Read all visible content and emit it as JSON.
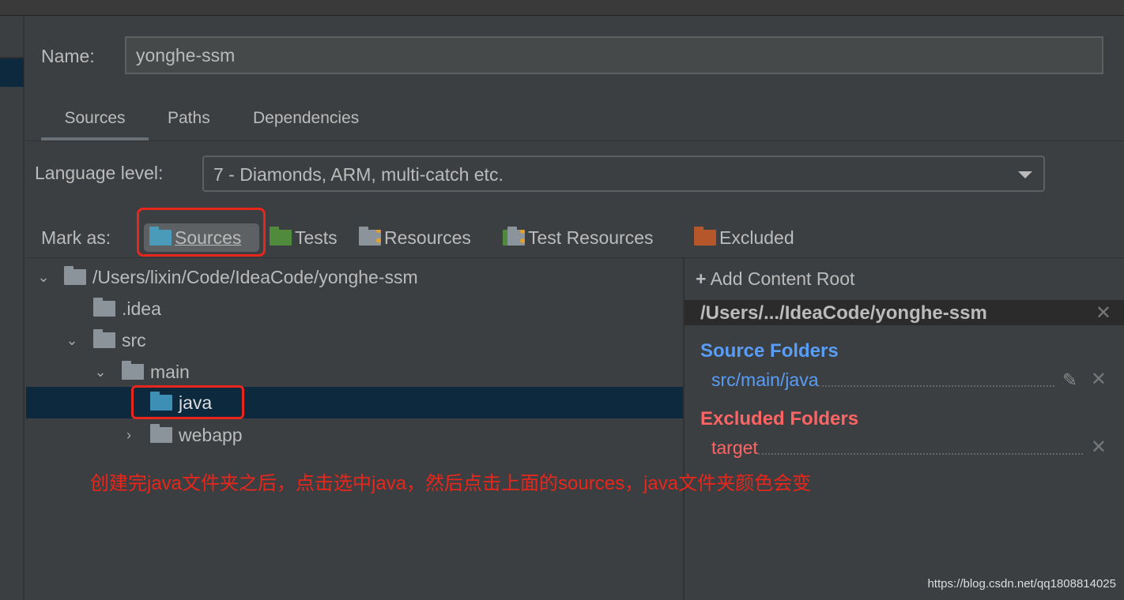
{
  "name_field": {
    "label": "Name:",
    "value": "yonghe-ssm"
  },
  "tabs": [
    {
      "label": "Sources",
      "active": true
    },
    {
      "label": "Paths"
    },
    {
      "label": "Dependencies"
    }
  ],
  "language_level": {
    "label": "Language level:",
    "value": "7 - Diamonds, ARM, multi-catch etc."
  },
  "mark_as": {
    "label": "Mark as:",
    "items": [
      {
        "label": "Sources",
        "color": "#4a9aba"
      },
      {
        "label": "Tests",
        "color": "#4f8a3d"
      },
      {
        "label": "Resources",
        "color": "#8a949a"
      },
      {
        "label": "Test Resources",
        "color": "#8a949a"
      },
      {
        "label": "Excluded",
        "color": "#b5572a"
      }
    ]
  },
  "tree": [
    {
      "label": "/Users/lixin/Code/IdeaCode/yonghe-ssm",
      "expanded": true
    },
    {
      "label": ".idea"
    },
    {
      "label": "src",
      "expanded": true
    },
    {
      "label": "main",
      "expanded": true
    },
    {
      "label": "java",
      "selected": true,
      "source": true
    },
    {
      "label": "webapp",
      "expanded": false
    }
  ],
  "annotation": "创建完java文件夹之后，点击选中java，然后点击上面的sources，java文件夹颜色会变",
  "content_root": {
    "add_label": "Add Content Root",
    "path": "/Users/.../IdeaCode/yonghe-ssm",
    "source_heading": "Source Folders",
    "source_items": [
      "src/main/java"
    ],
    "excluded_heading": "Excluded Folders",
    "excluded_items": [
      "target"
    ]
  },
  "watermark": "https://blog.csdn.net/qq1808814025"
}
